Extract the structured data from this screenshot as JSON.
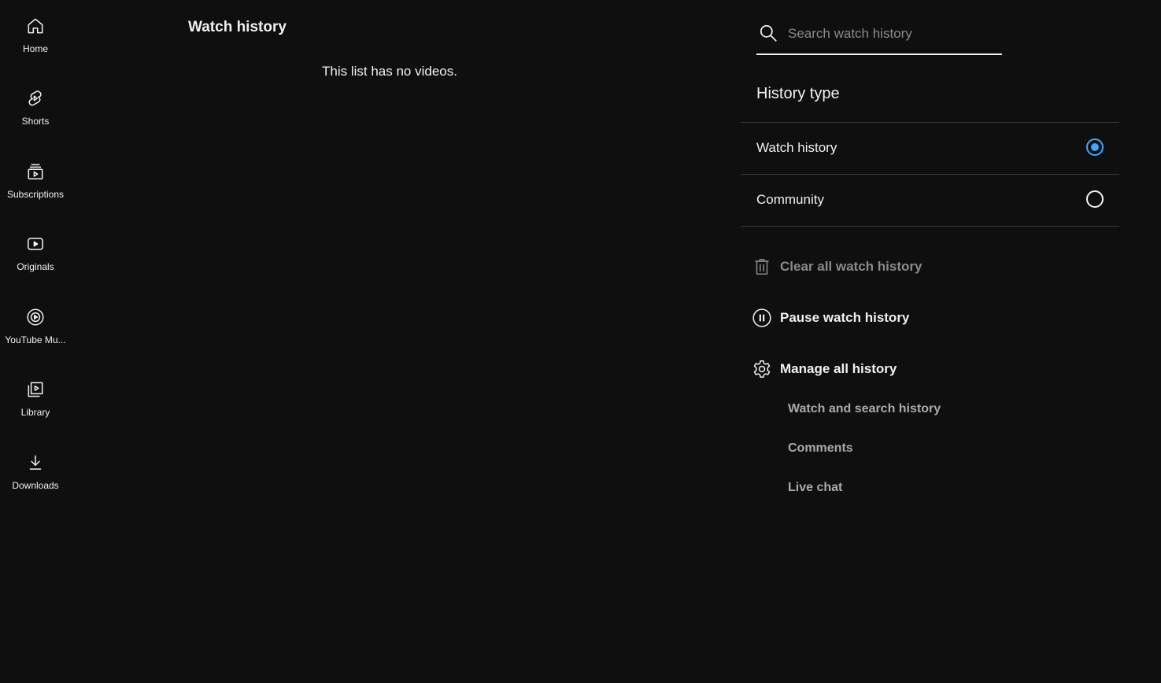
{
  "sidebar": {
    "items": [
      {
        "label": "Home",
        "icon": "home-icon"
      },
      {
        "label": "Shorts",
        "icon": "shorts-icon"
      },
      {
        "label": "Subscriptions",
        "icon": "subscriptions-icon"
      },
      {
        "label": "Originals",
        "icon": "originals-icon"
      },
      {
        "label": "YouTube Mu...",
        "icon": "youtube-music-icon"
      },
      {
        "label": "Library",
        "icon": "library-icon"
      },
      {
        "label": "Downloads",
        "icon": "download-icon"
      }
    ]
  },
  "main": {
    "title": "Watch history",
    "empty_message": "This list has no videos."
  },
  "panel": {
    "search": {
      "placeholder": "Search watch history",
      "value": ""
    },
    "history_type": {
      "title": "History type",
      "options": [
        {
          "label": "Watch history",
          "selected": true
        },
        {
          "label": "Community",
          "selected": false
        }
      ]
    },
    "actions": {
      "clear": {
        "label": "Clear all watch history",
        "enabled": false,
        "icon": "trash-icon"
      },
      "pause": {
        "label": "Pause watch history",
        "icon": "pause-circle-icon"
      },
      "manage": {
        "label": "Manage all history",
        "icon": "gear-icon"
      }
    },
    "manage_links": [
      "Watch and search history",
      "Comments",
      "Live chat"
    ]
  },
  "colors": {
    "background": "#0f0f0f",
    "text": "#f1f1f1",
    "muted": "#aaaaaa",
    "disabled": "#8a8a8a",
    "accent": "#3ea6ff",
    "divider": "#3a3a3a"
  }
}
